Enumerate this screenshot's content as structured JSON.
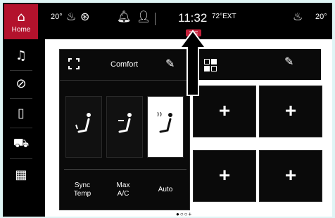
{
  "nav": {
    "home_label": "Home",
    "items": [
      {
        "icon": "music-note-icon",
        "glyph": "♫"
      },
      {
        "icon": "compass-icon",
        "glyph": "⊘"
      },
      {
        "icon": "phone-icon",
        "glyph": "▯"
      },
      {
        "icon": "car-icon",
        "glyph": "⛟"
      },
      {
        "icon": "apps-grid-icon",
        "glyph": "▦"
      }
    ]
  },
  "topbar": {
    "left_temp": "20°",
    "right_temp": "20°",
    "clock": "11:32",
    "outside_temp": "72°EXT"
  },
  "widget": {
    "title": "Comfort",
    "modes": [
      {
        "line1": "Sync",
        "line2": "Temp"
      },
      {
        "line1": "Max",
        "line2": "A/C"
      },
      {
        "line1": "Auto",
        "line2": ""
      }
    ]
  },
  "tiles": {
    "add_label": "+"
  },
  "pagination": {
    "indicator": "●○○+"
  },
  "colors": {
    "accent": "#b3122c",
    "background": "#000000"
  }
}
